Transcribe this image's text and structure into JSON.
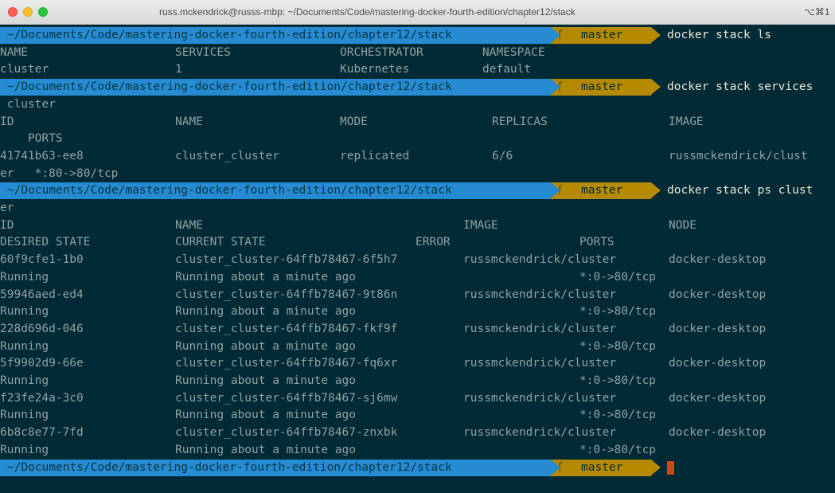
{
  "window": {
    "title": "russ.mckendrick@russs-mbp: ~/Documents/Code/mastering-docker-fourth-edition/chapter12/stack",
    "shortcut": "⌥⌘1"
  },
  "prompt": {
    "dir": "~/Documents/Code/mastering-docker-fourth-edition/chapter12/stack",
    "branch": "master",
    "branch_icon": "git-branch-icon"
  },
  "colors": {
    "background": "#002b36",
    "text": "#93a1a1",
    "prompt_dir_bg": "#268bd2",
    "prompt_git_bg": "#b58900",
    "cursor": "#cb4b16"
  },
  "lines": [
    {
      "kind": "prompt",
      "command": "docker stack ls"
    },
    {
      "kind": "text",
      "cells": [
        "NAME",
        "SERVICES",
        "ORCHESTRATOR",
        "NAMESPACE"
      ]
    },
    {
      "kind": "text",
      "cells": [
        "cluster",
        "1",
        "Kubernetes",
        "default"
      ]
    },
    {
      "kind": "prompt",
      "command": "docker stack services"
    },
    {
      "kind": "text",
      "cells": [
        " cluster"
      ]
    },
    {
      "kind": "text",
      "cells": [
        "ID",
        "NAME",
        "MODE",
        "REPLICAS",
        "IMAGE"
      ]
    },
    {
      "kind": "text",
      "cells": [
        "    PORTS"
      ]
    },
    {
      "kind": "text",
      "cells": [
        "41741b63-ee8",
        "cluster_cluster",
        "replicated",
        "6/6",
        "russmckendrick/clust"
      ]
    },
    {
      "kind": "text",
      "cells": [
        "er   *:80->80/tcp"
      ]
    },
    {
      "kind": "prompt",
      "command": "docker stack ps clust"
    },
    {
      "kind": "text",
      "cells": [
        "er"
      ]
    },
    {
      "kind": "text",
      "cells": [
        "ID",
        "NAME",
        "IMAGE",
        "NODE"
      ]
    },
    {
      "kind": "text",
      "cells": [
        "DESIRED STATE",
        "CURRENT STATE",
        "ERROR",
        "PORTS"
      ]
    },
    {
      "kind": "text",
      "cells": [
        "60f9cfe1-1b0",
        "cluster_cluster-64ffb78467-6f5h7",
        "russmckendrick/cluster",
        "docker-desktop"
      ]
    },
    {
      "kind": "text",
      "cells": [
        "Running",
        "Running about a minute ago",
        "*:0->80/tcp"
      ]
    },
    {
      "kind": "text",
      "cells": [
        "59946aed-ed4",
        "cluster_cluster-64ffb78467-9t86n",
        "russmckendrick/cluster",
        "docker-desktop"
      ]
    },
    {
      "kind": "text",
      "cells": [
        "Running",
        "Running about a minute ago",
        "*:0->80/tcp"
      ]
    },
    {
      "kind": "text",
      "cells": [
        "228d696d-046",
        "cluster_cluster-64ffb78467-fkf9f",
        "russmckendrick/cluster",
        "docker-desktop"
      ]
    },
    {
      "kind": "text",
      "cells": [
        "Running",
        "Running about a minute ago",
        "*:0->80/tcp"
      ]
    },
    {
      "kind": "text",
      "cells": [
        "5f9902d9-66e",
        "cluster_cluster-64ffb78467-fq6xr",
        "russmckendrick/cluster",
        "docker-desktop"
      ]
    },
    {
      "kind": "text",
      "cells": [
        "Running",
        "Running about a minute ago",
        "*:0->80/tcp"
      ]
    },
    {
      "kind": "text",
      "cells": [
        "f23fe24a-3c0",
        "cluster_cluster-64ffb78467-sj6mw",
        "russmckendrick/cluster",
        "docker-desktop"
      ]
    },
    {
      "kind": "text",
      "cells": [
        "Running",
        "Running about a minute ago",
        "*:0->80/tcp"
      ]
    },
    {
      "kind": "text",
      "cells": [
        "6b8c8e77-7fd",
        "cluster_cluster-64ffb78467-znxbk",
        "russmckendrick/cluster",
        "docker-desktop"
      ]
    },
    {
      "kind": "text",
      "cells": [
        "Running",
        "Running about a minute ago",
        "*:0->80/tcp"
      ]
    },
    {
      "kind": "prompt",
      "command": ""
    }
  ]
}
